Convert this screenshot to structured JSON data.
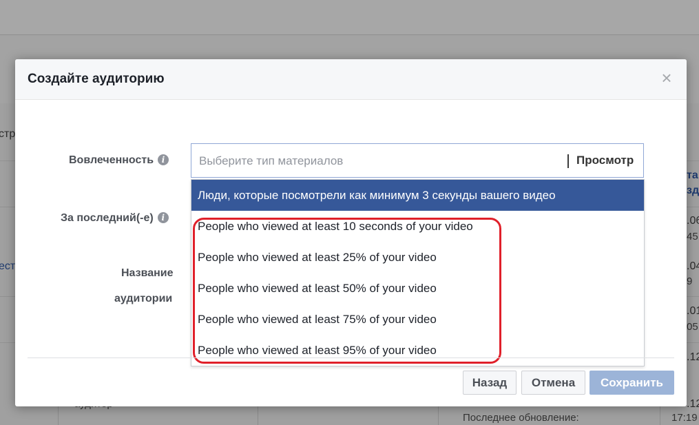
{
  "background": {
    "left_fragments": [
      "стр",
      "ест"
    ],
    "right_fragments": [
      "та",
      "зд",
      ".06",
      "45",
      ".04",
      "9",
      ".01",
      "05",
      ".12",
      ".12",
      "17:19"
    ],
    "bottom_text": "Последнее обновление:",
    "bottom_left_text": "аудитор"
  },
  "modal": {
    "title": "Создайте аудиторию",
    "close_symbol": "×",
    "engagement_label": "Вовлеченность",
    "period_label": "За последний(-е)",
    "name_label_line1": "Название",
    "name_label_line2": "аудитории",
    "info_glyph": "i",
    "select": {
      "placeholder": "Выберите тип материалов",
      "preview_label": "Просмотр"
    },
    "dropdown_items": [
      "Люди, которые посмотрели как минимум 3 секунды вашего видео",
      "People who viewed at least 10 seconds of your video",
      "People who viewed at least 25% of your video",
      "People who viewed at least 50% of your video",
      "People who viewed at least 75% of your video",
      "People who viewed at least 95% of your video"
    ],
    "buttons": {
      "back": "Назад",
      "cancel": "Отмена",
      "save": "Сохранить"
    }
  },
  "colors": {
    "selected_item": "#365899",
    "highlight_ring": "#e0202a",
    "save_disabled": "#9cb4d8"
  }
}
